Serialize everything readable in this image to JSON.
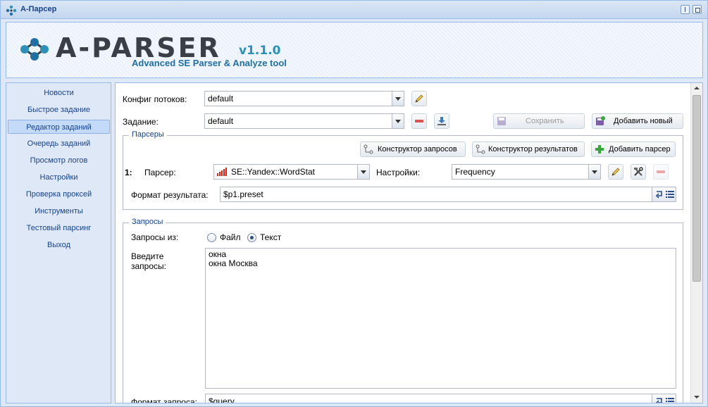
{
  "window": {
    "title": "А-Парсер"
  },
  "logo": {
    "name": "A-PARSER",
    "version": "v1.1.0",
    "tagline": "Advanced SE Parser & Analyze tool"
  },
  "sidebar": {
    "items": [
      {
        "label": "Новости"
      },
      {
        "label": "Быстрое задание"
      },
      {
        "label": "Редактор заданий",
        "active": true
      },
      {
        "label": "Очередь заданий"
      },
      {
        "label": "Просмотр логов"
      },
      {
        "label": "Настройки"
      },
      {
        "label": "Проверка проксей"
      },
      {
        "label": "Инструменты"
      },
      {
        "label": "Тестовый парсинг"
      },
      {
        "label": "Выход"
      }
    ]
  },
  "form": {
    "threads_config_label": "Конфиг потоков:",
    "threads_config_value": "default",
    "task_label": "Задание:",
    "task_value": "default",
    "save_button": "Сохранить",
    "add_new_button": "Добавить новый"
  },
  "parsers": {
    "legend": "Парсеры",
    "query_builder_button": "Конструктор запросов",
    "result_builder_button": "Конструктор результатов",
    "add_parser_button": "Добавить парсер",
    "row_index": "1:",
    "parser_label": "Парсер:",
    "parser_value": "SE::Yandex::WordStat",
    "settings_label": "Настройки:",
    "settings_value": "Frequency",
    "result_format_label": "Формат результата:",
    "result_format_value": "$p1.preset"
  },
  "queries": {
    "legend": "Запросы",
    "source_label": "Запросы из:",
    "option_file": "Файл",
    "option_text": "Текст",
    "selected": "Текст",
    "enter_label_line1": "Введите",
    "enter_label_line2": "запросы:",
    "lines": [
      "окна",
      "окна Москва"
    ],
    "query_format_label": "Формат запроса:",
    "query_format_value": "$query"
  },
  "colors": {
    "accent": "#15428b",
    "border": "#99bbe8",
    "panel": "#dfe8f6"
  }
}
